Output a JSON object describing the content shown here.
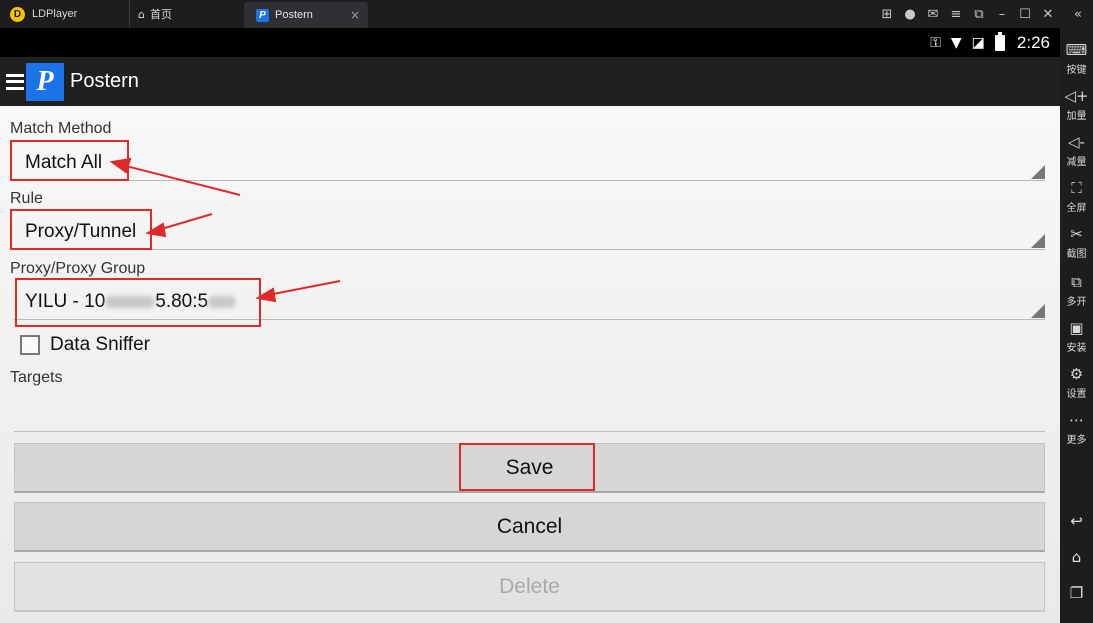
{
  "host": {
    "brand": "LDPlayer",
    "home_tab": "首页",
    "active_tab": "Postern",
    "close_tab": "×",
    "window_controls": [
      "gamepad-icon",
      "user-icon",
      "mail-icon",
      "menu-icon",
      "restore-icon",
      "minimize-icon",
      "maximize-icon",
      "close-icon",
      "collapse-icon"
    ]
  },
  "status_bar": {
    "time": "2:26",
    "icons": [
      "vpn-key-icon",
      "wifi-icon",
      "no-sim-icon",
      "battery-icon"
    ]
  },
  "app_bar": {
    "title": "Postern",
    "logo_letter": "P"
  },
  "form": {
    "match_method": {
      "label": "Match Method",
      "value": "Match All"
    },
    "rule": {
      "label": "Rule",
      "value": "Proxy/Tunnel"
    },
    "proxy": {
      "label": "Proxy/Proxy Group",
      "value_prefix": "YILU - 10",
      "value_middle": "5.80:5"
    },
    "data_sniffer": {
      "label": "Data Sniffer",
      "checked": false
    },
    "targets": {
      "label": "Targets",
      "value": ""
    }
  },
  "buttons": {
    "save": "Save",
    "cancel": "Cancel",
    "delete": "Delete"
  },
  "sidebar": {
    "items": [
      {
        "icon": "keyboard-icon",
        "label": "按键"
      },
      {
        "icon": "volume-up-icon",
        "label": "加量"
      },
      {
        "icon": "volume-down-icon",
        "label": "减量"
      },
      {
        "icon": "fullscreen-icon",
        "label": "全屏"
      },
      {
        "icon": "screenshot-icon",
        "label": "截图"
      },
      {
        "icon": "multi-instance-icon",
        "label": "多开"
      },
      {
        "icon": "apk-install-icon",
        "label": "安装"
      },
      {
        "icon": "settings-icon",
        "label": "设置"
      },
      {
        "icon": "more-icon",
        "label": "更多"
      }
    ],
    "nav": [
      "back-icon",
      "home-icon",
      "recents-icon"
    ]
  },
  "annotation_color": "#e02a2a"
}
